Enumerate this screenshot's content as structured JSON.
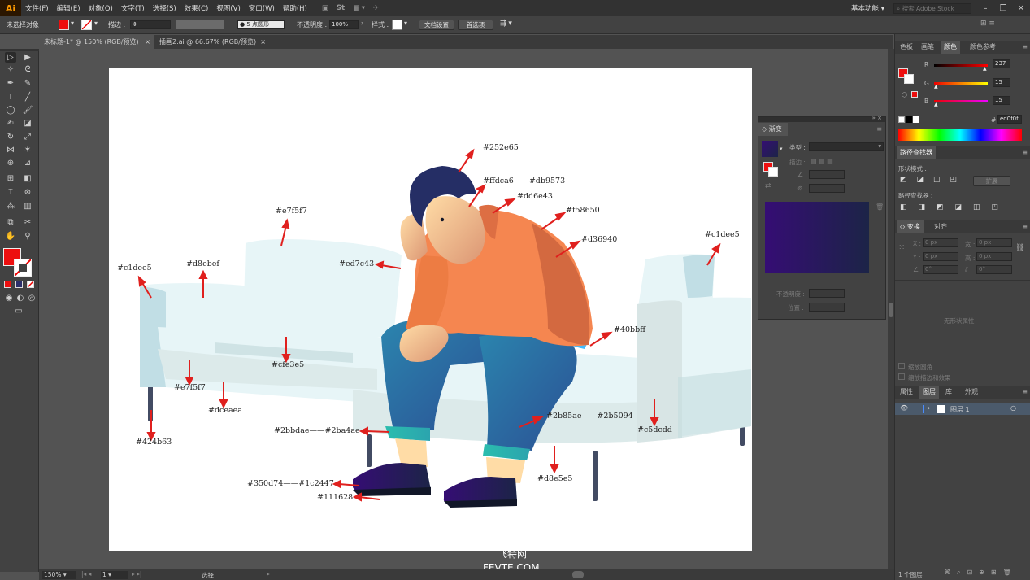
{
  "app": {
    "logo": "Ai",
    "menus": [
      "文件(F)",
      "编辑(E)",
      "对象(O)",
      "文字(T)",
      "选择(S)",
      "效果(C)",
      "视图(V)",
      "窗口(W)",
      "帮助(H)"
    ],
    "workspace": "基本功能",
    "search_placeholder": "搜索 Adobe Stock"
  },
  "control_bar": {
    "no_selection": "未选择对象",
    "stroke_label": "描边 :",
    "brush_label": "5 点圆形",
    "opacity_label": "不透明度 :",
    "opacity_value": "100%",
    "style_label": "样式 :",
    "doc_setup": "文档设置",
    "preferences": "首选项"
  },
  "tabs": [
    {
      "label": "未标题-1* @ 150% (RGB/预览)",
      "close": "×"
    },
    {
      "label": "插画2.ai @ 66.67% (RGB/预览)",
      "close": "×"
    }
  ],
  "annotations": [
    "#252e65",
    "#ffdca6——#db9573",
    "#dd6e43",
    "#f58650",
    "#d36940",
    "#c1dee5",
    "#e7f5f7",
    "#c1dee5",
    "#d8ebef",
    "#ed7c43",
    "#40bbff",
    "#cfe3e5",
    "#e7f5f7",
    "#dceaea",
    "#424b63",
    "#2bbdae——#2ba4ae",
    "#2b85ae——#2b5094",
    "#c5dcdd",
    "#d8e5e5",
    "#350d74——#1c2447",
    "#111628"
  ],
  "color_panel": {
    "tabs": [
      "色板",
      "画笔",
      "颜色",
      "颜色参考"
    ],
    "r_label": "R",
    "r_value": "237",
    "g_label": "G",
    "g_value": "15",
    "b_label": "B",
    "b_value": "15",
    "hex_label": "#",
    "hex_value": "ed0f0f"
  },
  "pathfinder": {
    "title": "路径查找器",
    "shape_modes": "形状模式 :",
    "expand": "扩展",
    "pathfinders": "路径查找器 :"
  },
  "transform": {
    "tabs": [
      "变换",
      "对齐"
    ],
    "x_label": "X :",
    "x_value": "0 px",
    "y_label": "Y :",
    "y_value": "0 px",
    "w_label": "宽 :",
    "w_value": "0 px",
    "h_label": "高 :",
    "h_value": "0 px",
    "angle_value": "0°",
    "shear_value": "0°",
    "no_state": "无形状属性",
    "scale_corners": "缩放圆角",
    "scale_strokes": "缩放描边和效果"
  },
  "layers": {
    "tabs": [
      "属性",
      "图层",
      "库",
      "外观"
    ],
    "layer_name": "图层 1",
    "count": "1 个图层"
  },
  "gradient_panel": {
    "title": "渐变",
    "type_label": "类型 :",
    "stroke_label": "描边 :",
    "opacity_label": "不透明度 :",
    "location_label": "位置 :"
  },
  "status": {
    "zoom": "150%",
    "page": "1",
    "tool": "选择"
  },
  "watermark": {
    "cn": "飞特网",
    "en": "FEVTE.COM"
  },
  "colors": {
    "fill": "#ed0f0f",
    "gradient_start": "#350d74",
    "gradient_end": "#1c2447"
  }
}
